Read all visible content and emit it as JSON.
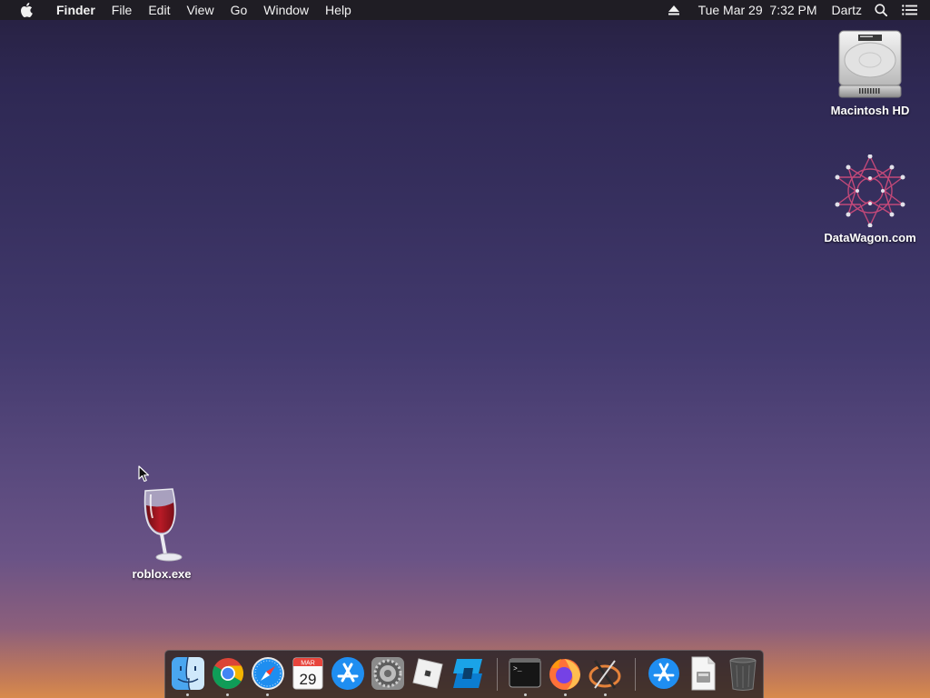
{
  "menubar": {
    "app_name": "Finder",
    "menus": [
      "File",
      "Edit",
      "View",
      "Go",
      "Window",
      "Help"
    ],
    "clock": "Tue Mar 29  7:32 PM",
    "user": "Dartz"
  },
  "desktop": {
    "icons": [
      {
        "label": "Macintosh HD",
        "icon": "hard-drive-icon"
      },
      {
        "label": "DataWagon.com",
        "icon": "star-network-icon"
      },
      {
        "label": "roblox.exe",
        "icon": "wine-glass-icon"
      }
    ]
  },
  "dock": {
    "apps": [
      {
        "name": "finder-icon",
        "running": true
      },
      {
        "name": "chrome-icon",
        "running": true
      },
      {
        "name": "safari-icon",
        "running": true
      },
      {
        "name": "calendar-icon",
        "running": false,
        "month": "MAR",
        "day": "29"
      },
      {
        "name": "app-store-icon",
        "running": false
      },
      {
        "name": "system-preferences-icon",
        "running": false
      },
      {
        "name": "roblox-icon",
        "running": false
      },
      {
        "name": "roblox-studio-icon",
        "running": false
      },
      {
        "name": "terminal-icon",
        "running": true,
        "prompt": ">_"
      },
      {
        "name": "firefox-icon",
        "running": true
      },
      {
        "name": "xquartz-icon",
        "running": true
      },
      {
        "name": "app-store-downloads-icon",
        "running": false
      },
      {
        "name": "documents-stack-icon",
        "running": false
      },
      {
        "name": "trash-icon",
        "running": false
      }
    ]
  },
  "colors": {
    "menubar_bg": "#1f1d24",
    "wallpaper_top": "#26203f",
    "wallpaper_bottom": "#d88a4c"
  }
}
